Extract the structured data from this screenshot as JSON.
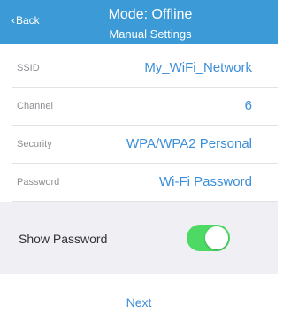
{
  "header": {
    "back_label": "Back",
    "title": "Mode: Offline",
    "subtitle": "Manual Settings"
  },
  "fields": [
    {
      "label": "SSID",
      "value": "My_WiFi_Network"
    },
    {
      "label": "Channel",
      "value": "6"
    },
    {
      "label": "Security",
      "value": "WPA/WPA2 Personal"
    },
    {
      "label": "Password",
      "value": "Wi-Fi  Password"
    }
  ],
  "show_password": {
    "label": "Show Password",
    "enabled": true
  },
  "next_label": "Next",
  "colors": {
    "header_bg": "#3c9ad6",
    "accent": "#3c8ed8",
    "toggle_on": "#4cd964",
    "section_bg": "#efeff4"
  },
  "icons": {
    "back": "chevron-left-icon"
  }
}
